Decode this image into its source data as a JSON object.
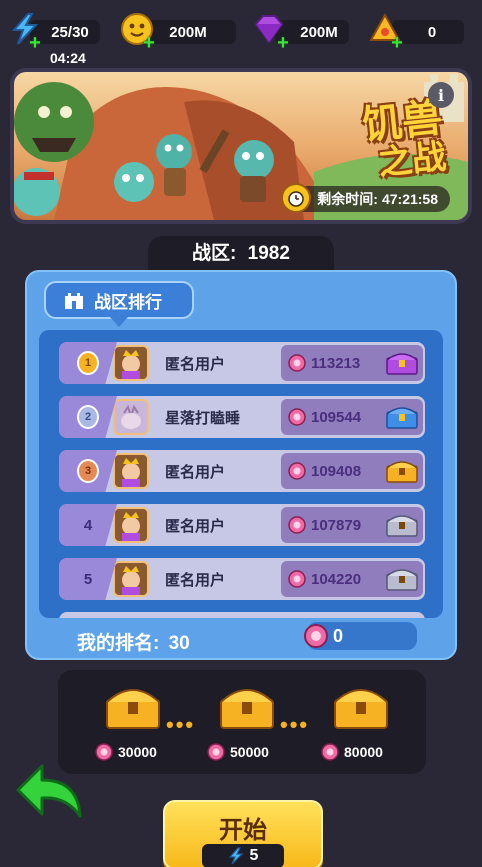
{
  "resources": {
    "energy": "25/30",
    "energy_timer": "04:24",
    "gold": "200M",
    "gems": "200M",
    "tickets": "0"
  },
  "banner": {
    "title_line1": "饥兽",
    "title_line2": "之战",
    "remaining_label": "剩余时间:",
    "remaining_time": "47:21:58",
    "info_icon_text": "i"
  },
  "zone": {
    "label": "战区:",
    "number": "1982"
  },
  "ranking": {
    "tab_label": "战区排行",
    "rows": [
      {
        "rank": "1",
        "name": "匿名用户",
        "score": "113213",
        "chest": "purple"
      },
      {
        "rank": "2",
        "name": "星落打瞌睡",
        "score": "109544",
        "chest": "blue"
      },
      {
        "rank": "3",
        "name": "匿名用户",
        "score": "109408",
        "chest": "gold"
      },
      {
        "rank": "4",
        "name": "匿名用户",
        "score": "107879",
        "chest": "silver"
      },
      {
        "rank": "5",
        "name": "匿名用户",
        "score": "104220",
        "chest": "silver"
      }
    ],
    "my_rank_label": "我的排名:",
    "my_rank": "30",
    "my_score": "0"
  },
  "rewards": [
    {
      "threshold": "30000"
    },
    {
      "threshold": "50000"
    },
    {
      "threshold": "80000"
    }
  ],
  "start": {
    "label": "开始",
    "cost": "5"
  },
  "colors": {
    "medal_1": "#f6b223",
    "medal_2": "#a9b8e4",
    "medal_3": "#e48a55"
  }
}
